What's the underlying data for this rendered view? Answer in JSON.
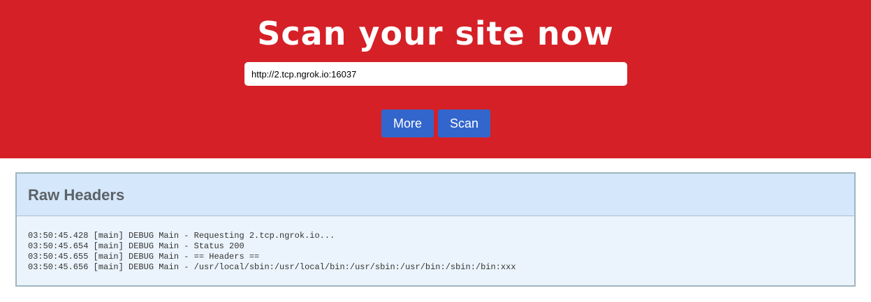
{
  "hero": {
    "title": "Scan your site now",
    "url_value": "http://2.tcp.ngrok.io:16037",
    "more_label": "More",
    "scan_label": "Scan"
  },
  "panel": {
    "title": "Raw Headers",
    "lines": [
      "03:50:45.428 [main] DEBUG Main - Requesting 2.tcp.ngrok.io...",
      "03:50:45.654 [main] DEBUG Main - Status 200",
      "03:50:45.655 [main] DEBUG Main - == Headers ==",
      "03:50:45.656 [main] DEBUG Main - /usr/local/sbin:/usr/local/bin:/usr/sbin:/usr/bin:/sbin:/bin:xxx"
    ]
  },
  "colors": {
    "hero_background": "#d52027",
    "button_background": "#3366cc",
    "panel_header_background": "#d5e7fb",
    "panel_body_background": "#ebf4fc"
  }
}
